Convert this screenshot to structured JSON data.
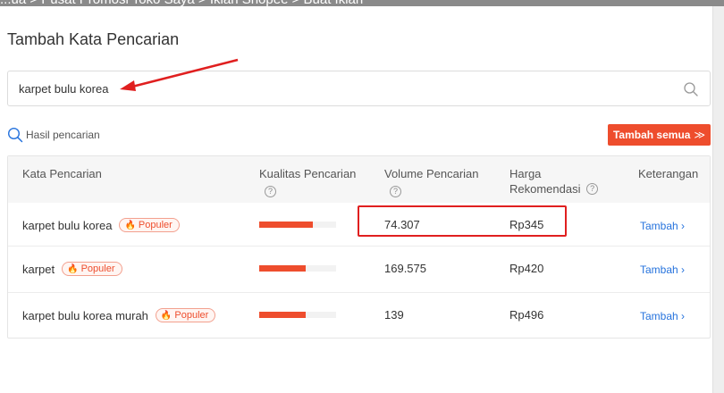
{
  "breadcrumb": "...ua  >  Pusat Promosi Toko Saya  >  Iklan Shopee  >  Buat Iklan",
  "page": {
    "title": "Tambah Kata Pencarian"
  },
  "search": {
    "value": "karpet bulu korea"
  },
  "results": {
    "label": "Hasil pencarian"
  },
  "buttons": {
    "add_all": "Tambah semua",
    "add_all_chevron": "≫"
  },
  "table": {
    "headers": {
      "keyword": "Kata Pencarian",
      "quality": "Kualitas Pencarian",
      "volume": "Volume Pencarian",
      "price_line1": "Harga",
      "price_line2": "Rekomendasi",
      "notes": "Keterangan"
    },
    "help_icon": "?",
    "rows": [
      {
        "keyword": "karpet bulu korea",
        "badge": "Populer",
        "quality": 0.7,
        "volume": "74.307",
        "price": "Rp345",
        "action": "Tambah ›"
      },
      {
        "keyword": "karpet",
        "badge": "Populer",
        "quality": 0.6,
        "volume": "169.575",
        "price": "Rp420",
        "action": "Tambah ›"
      },
      {
        "keyword": "karpet bulu korea murah",
        "badge": "Populer",
        "quality": 0.6,
        "volume": "139",
        "price": "Rp496",
        "action": "Tambah ›"
      }
    ]
  },
  "colors": {
    "accent": "#ee4d2d",
    "link": "#2673dd",
    "annotation": "#e01f1f"
  },
  "icons": {
    "search": "search-icon",
    "results": "search-icon",
    "badge": "flame-icon",
    "help": "question-circle-icon"
  }
}
